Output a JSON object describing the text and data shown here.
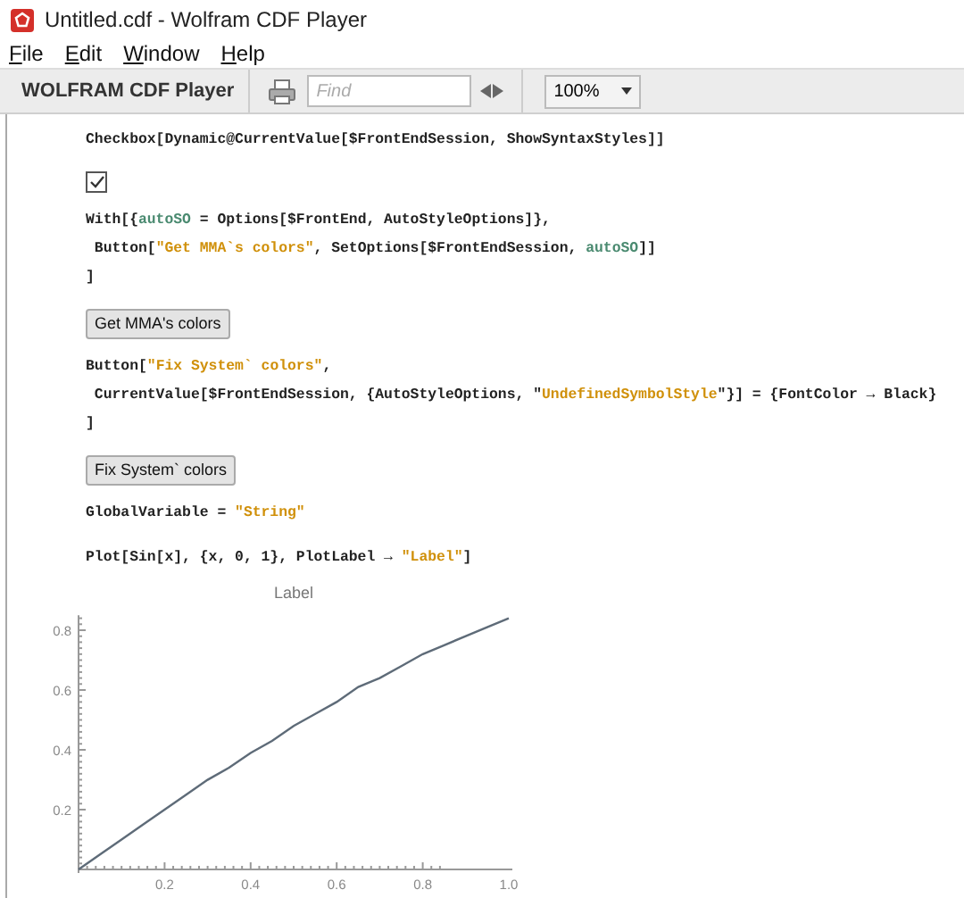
{
  "window": {
    "title": "Untitled.cdf - Wolfram CDF Player"
  },
  "menu": [
    "File",
    "Edit",
    "Window",
    "Help"
  ],
  "toolbar": {
    "brand": "WOLFRAM CDF Player",
    "find": {
      "placeholder": "Find"
    },
    "zoom": "100%"
  },
  "cells": [
    {
      "kind": "code",
      "lines": [
        [
          {
            "text": "Checkbox[Dynamic@CurrentValue[$FrontEndSession, ShowSyntaxStyles]]",
            "kind": "plain"
          }
        ]
      ]
    },
    {
      "kind": "checkbox",
      "checked": true
    },
    {
      "kind": "code",
      "lines": [
        [
          {
            "text": "With[{",
            "kind": "plain"
          },
          {
            "text": "autoSO",
            "kind": "local"
          },
          {
            "text": " = Options[$FrontEnd, AutoStyleOptions]},",
            "kind": "plain"
          }
        ],
        [
          {
            "text": " Button[",
            "kind": "plain"
          },
          {
            "text": "\"Get MMA`s colors\"",
            "kind": "string"
          },
          {
            "text": ", SetOptions[$FrontEndSession, ",
            "kind": "plain"
          },
          {
            "text": "autoSO",
            "kind": "local"
          },
          {
            "text": "]]",
            "kind": "plain"
          }
        ],
        [
          {
            "text": "]",
            "kind": "plain"
          }
        ]
      ]
    },
    {
      "kind": "button",
      "label": "Get MMA's colors"
    },
    {
      "kind": "code",
      "lines": [
        [
          {
            "text": "Button[",
            "kind": "plain"
          },
          {
            "text": "\"Fix System` colors\"",
            "kind": "string"
          },
          {
            "text": ",",
            "kind": "plain"
          }
        ],
        [
          {
            "text": " CurrentValue[$FrontEndSession, {AutoStyleOptions, \"",
            "kind": "plain"
          },
          {
            "text": "UndefinedSymbolStyle",
            "kind": "string"
          },
          {
            "text": "\"}] = {FontColor → Black}",
            "kind": "plain"
          }
        ],
        [
          {
            "text": "]",
            "kind": "plain"
          }
        ]
      ]
    },
    {
      "kind": "button",
      "label": "Fix System` colors"
    },
    {
      "kind": "code",
      "lines": [
        [
          {
            "text": "GlobalVariable = ",
            "kind": "plain"
          },
          {
            "text": "\"String\"",
            "kind": "string"
          }
        ]
      ]
    },
    {
      "kind": "code",
      "lines": [
        [
          {
            "text": "Plot[Sin[x], {x, 0, 1}, PlotLabel → ",
            "kind": "plain"
          },
          {
            "text": "\"Label\"",
            "kind": "string"
          },
          {
            "text": "]",
            "kind": "plain"
          }
        ]
      ]
    },
    {
      "kind": "plot",
      "chart_data": {
        "type": "line",
        "title": "Label",
        "x": [
          0,
          0.05,
          0.1,
          0.15,
          0.2,
          0.25,
          0.3,
          0.35,
          0.4,
          0.45,
          0.5,
          0.55,
          0.6,
          0.65,
          0.7,
          0.75,
          0.8,
          0.85,
          0.9,
          0.95,
          1.0
        ],
        "series": [
          {
            "color": "#5e6b78",
            "values": [
              0,
              0.05,
              0.1,
              0.15,
              0.2,
              0.25,
              0.3,
              0.34,
              0.39,
              0.43,
              0.48,
              0.52,
              0.56,
              0.61,
              0.64,
              0.68,
              0.72,
              0.75,
              0.78,
              0.81,
              0.84
            ]
          }
        ],
        "xlim": [
          0,
          1
        ],
        "ylim": [
          0,
          0.85
        ],
        "xticks": [
          {
            "value": 0.2,
            "label": "0.2"
          },
          {
            "value": 0.4,
            "label": "0.4"
          },
          {
            "value": 0.6,
            "label": "0.6"
          },
          {
            "value": 0.8,
            "label": "0.8"
          },
          {
            "value": 1.0,
            "label": "1.0"
          }
        ],
        "yticks": [
          {
            "value": 0.2,
            "label": "0.2"
          },
          {
            "value": 0.4,
            "label": "0.4"
          },
          {
            "value": 0.6,
            "label": "0.6"
          },
          {
            "value": 0.8,
            "label": "0.8"
          }
        ]
      }
    }
  ]
}
